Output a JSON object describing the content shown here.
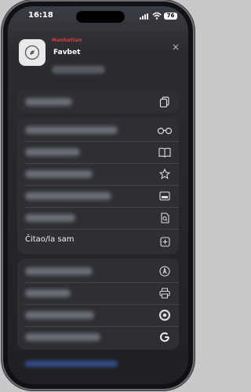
{
  "status": {
    "time": "16:18",
    "battery": "76"
  },
  "header": {
    "brand_text": "Manhattan",
    "site_title": "Favbet",
    "close_label": "×"
  },
  "menu": {
    "read_label": "Čitao/la sam"
  },
  "icons": {
    "compass": "compass-icon",
    "copy": "copy-icon",
    "glasses": "reading-list-icon",
    "book": "bookmarks-icon",
    "star": "favorite-star-icon",
    "card": "view-card-icon",
    "search_page": "find-on-page-icon",
    "add": "add-icon",
    "markup": "markup-icon",
    "print": "print-icon",
    "chrome": "chrome-icon",
    "google": "google-icon"
  }
}
